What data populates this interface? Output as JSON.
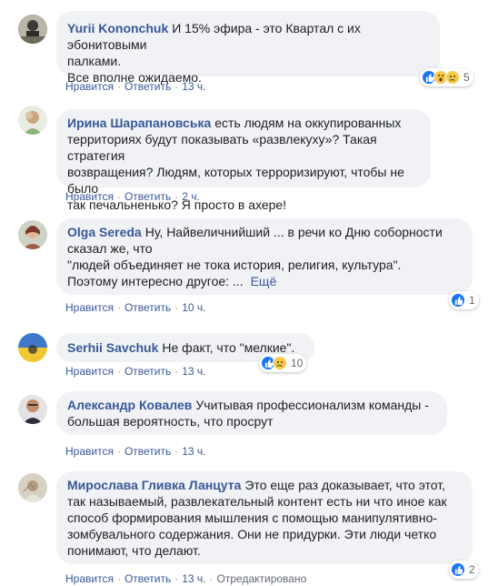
{
  "actions": {
    "like": "Нравится",
    "reply": "Ответить",
    "dot": "·"
  },
  "comments": [
    {
      "author": "Yurii Kononchuk",
      "text": "И 15% эфира - это Квартал с их эбонитовыми\nпалками.\nВсе вполне ожидаемо.",
      "time": "13 ч.",
      "reactions": "5"
    },
    {
      "author": "Ирина Шарапановська",
      "text": "есть людям на оккупированных\nтерриториях будут показывать «развлекуху»? Такая стратегия\nвозвращения? Людям, которых терроризируют, чтобы не было\nтак печальненько? Я просто в ахере!",
      "time": "2 ч."
    },
    {
      "author": "Olga Sereda",
      "text": "Ну, Найвеличнийший ... в речи ко Дню соборности\nсказал же, что\n\"людей объединяет не тока история, религия, культура\".\nПоэтому интересно другое: ...",
      "more": "Ещё",
      "time": "10 ч.",
      "reactions": "1"
    },
    {
      "author": "Serhii Savchuk",
      "text": "Не факт, что \"мелкие\".",
      "time": "13 ч.",
      "reactions": "10"
    },
    {
      "author": "Александр Ковалев",
      "text": "Учитывая профессионализм команды -\nбольшая вероятность, что просрут",
      "time": "13 ч."
    },
    {
      "author": "Мирослава Гливка Ланцута",
      "text": "Это еще раз доказывает, что этот,\nтак называемый, развлекательный контент есть ни что иное как\nспособ формирования мышления с помощью манипулятивно-\nзомбувального содержания. Они не придурки. Эти люди четко\nпонимают, что делают.",
      "time": "13 ч.",
      "edited": "Отредактировано",
      "reactions": "2"
    }
  ]
}
